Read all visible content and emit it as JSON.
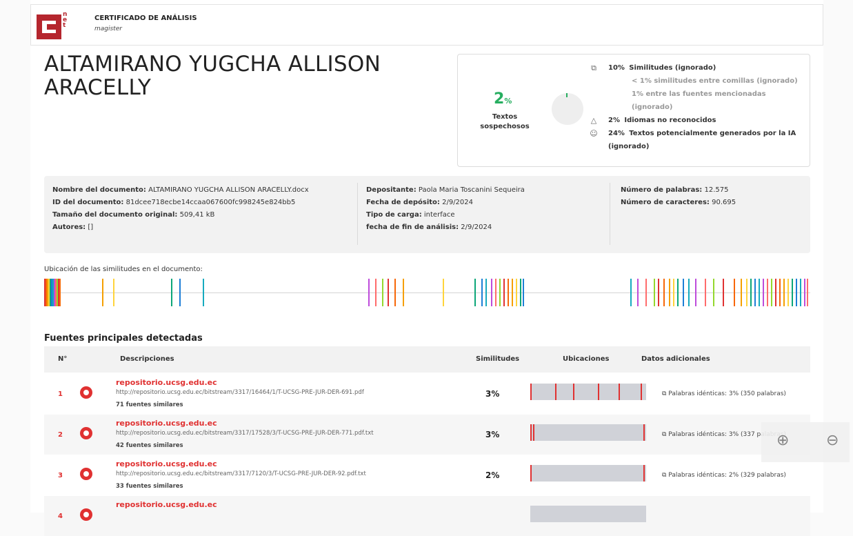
{
  "header": {
    "logo_text": "C.net",
    "title": "CERTIFICADO DE ANÁLISIS",
    "subtitle": "magister"
  },
  "student_name": "ALTAMIRANO YUGCHA ALLISON ARACELLY",
  "summary": {
    "percent": "2",
    "percent_unit": "%",
    "label": "Textos sospechosos",
    "donut_fill": 0.02,
    "rows": [
      {
        "icon": "copy-icon",
        "pct": "10%",
        "label": "Similitudes (ignorado)"
      },
      {
        "sub": "< 1% similitudes entre comillas (ignorado)"
      },
      {
        "sub": "1% entre las fuentes mencionadas (ignorado)"
      },
      {
        "icon": "warning-icon",
        "pct": "2%",
        "label": "Idiomas no reconocidos"
      },
      {
        "icon": "robot-icon",
        "pct": "24%",
        "label": "Textos potencialmente generados por la IA (ignorado)"
      }
    ]
  },
  "meta": {
    "col1": [
      {
        "k": "Nombre del documento:",
        "v": "ALTAMIRANO YUGCHA ALLISON ARACELLY.docx"
      },
      {
        "k": "ID del documento:",
        "v": "81dcee718ecbe14ccaa067600fc998245e824bb5"
      },
      {
        "k": "Tamaño del documento original:",
        "v": "509,41 kB"
      },
      {
        "k": "Autores:",
        "v": "[]"
      }
    ],
    "col2": [
      {
        "k": "Depositante:",
        "v": "Paola Maria Toscanini Sequeira"
      },
      {
        "k": "Fecha de depósito:",
        "v": "2/9/2024"
      },
      {
        "k": "Tipo de carga:",
        "v": "interface"
      },
      {
        "k": "fecha de fin de análisis:",
        "v": "2/9/2024"
      }
    ],
    "col3": [
      {
        "k": "Número de palabras:",
        "v": "12.575"
      },
      {
        "k": "Número de caracteres:",
        "v": "90.695"
      }
    ]
  },
  "location": {
    "title": "Ubicación de las similitudes en el documento:",
    "colors": [
      "#e03131",
      "#f76707",
      "#f59f00",
      "#ffd43b",
      "#0ca678",
      "#1c7ed6",
      "#15aabf",
      "#be4bdb",
      "#ff6b6b",
      "#94d82d"
    ]
  },
  "sources": {
    "title": "Fuentes principales detectadas",
    "headers": {
      "num": "N°",
      "desc": "Descripciones",
      "sim": "Similitudes",
      "loc": "Ubicaciones",
      "extra": "Datos adicionales"
    },
    "rows": [
      {
        "num": "1",
        "domain": "repositorio.ucsg.edu.ec",
        "url": "http://repositorio.ucsg.edu.ec/bitstream/3317/16464/1/T-UCSG-PRE-JUR-DER-691.pdf",
        "similar": "71 fuentes similares",
        "pct": "3%",
        "extra": "Palabras idénticas: 3% (350 palabras)"
      },
      {
        "num": "2",
        "domain": "repositorio.ucsg.edu.ec",
        "url": "http://repositorio.ucsg.edu.ec/bitstream/3317/17528/3/T-UCSG-PRE-JUR-DER-771.pdf.txt",
        "similar": "42 fuentes similares",
        "pct": "3%",
        "extra": "Palabras idénticas: 3% (337 palabras)"
      },
      {
        "num": "3",
        "domain": "repositorio.ucsg.edu.ec",
        "url": "http://repositorio.ucsg.edu.ec/bitstream/3317/7120/3/T-UCSG-PRE-JUR-DER-92.pdf.txt",
        "similar": "33 fuentes similares",
        "pct": "2%",
        "extra": "Palabras idénticas: 2% (329 palabras)"
      },
      {
        "num": "4",
        "domain": "repositorio.ucsg.edu.ec",
        "url": "",
        "similar": "",
        "pct": "",
        "extra": ""
      }
    ]
  },
  "zoom": {
    "in": "⊕",
    "out": "⊖"
  }
}
